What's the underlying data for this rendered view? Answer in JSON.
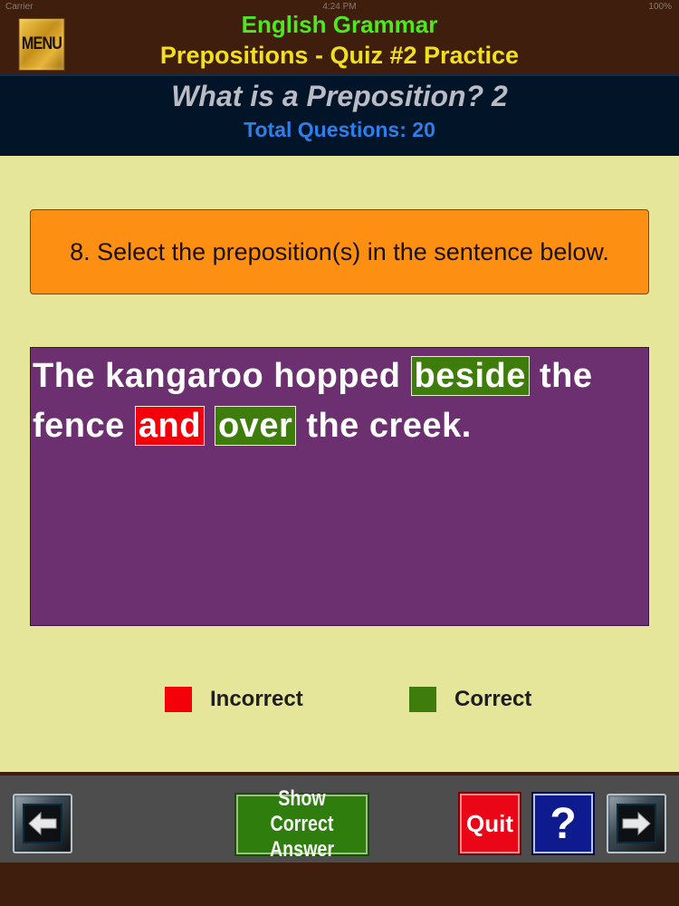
{
  "status_bar": {
    "carrier": "Carrier",
    "time": "4:24 PM",
    "battery": "100%"
  },
  "header": {
    "menu_label": "MENU",
    "title": "English Grammar",
    "subtitle": "Prepositions - Quiz #2 Practice"
  },
  "quiz": {
    "title": "What is a Preposition? 2",
    "total_questions": "Total Questions: 20"
  },
  "question": {
    "text": "8. Select the preposition(s) in the sentence below."
  },
  "sentence": {
    "words": [
      {
        "text": "The",
        "state": "none"
      },
      {
        "text": "kangaroo",
        "state": "none"
      },
      {
        "text": "hopped",
        "state": "none"
      },
      {
        "text": "beside",
        "state": "correct"
      },
      {
        "text": "the",
        "state": "none"
      },
      {
        "text": "fence",
        "state": "none"
      },
      {
        "text": "and",
        "state": "incorrect"
      },
      {
        "text": "over",
        "state": "correct"
      },
      {
        "text": "the",
        "state": "none"
      },
      {
        "text": "creek.",
        "state": "none"
      }
    ]
  },
  "legend": {
    "incorrect_label": "Incorrect",
    "correct_label": "Correct",
    "incorrect_color": "#f4000a",
    "correct_color": "#3e7c0b"
  },
  "toolbar": {
    "back_icon": "arrow-left-icon",
    "show_answer_line1": "Show",
    "show_answer_line2": "Correct Answer",
    "quit_label": "Quit",
    "help_label": "?",
    "next_icon": "arrow-right-icon"
  }
}
